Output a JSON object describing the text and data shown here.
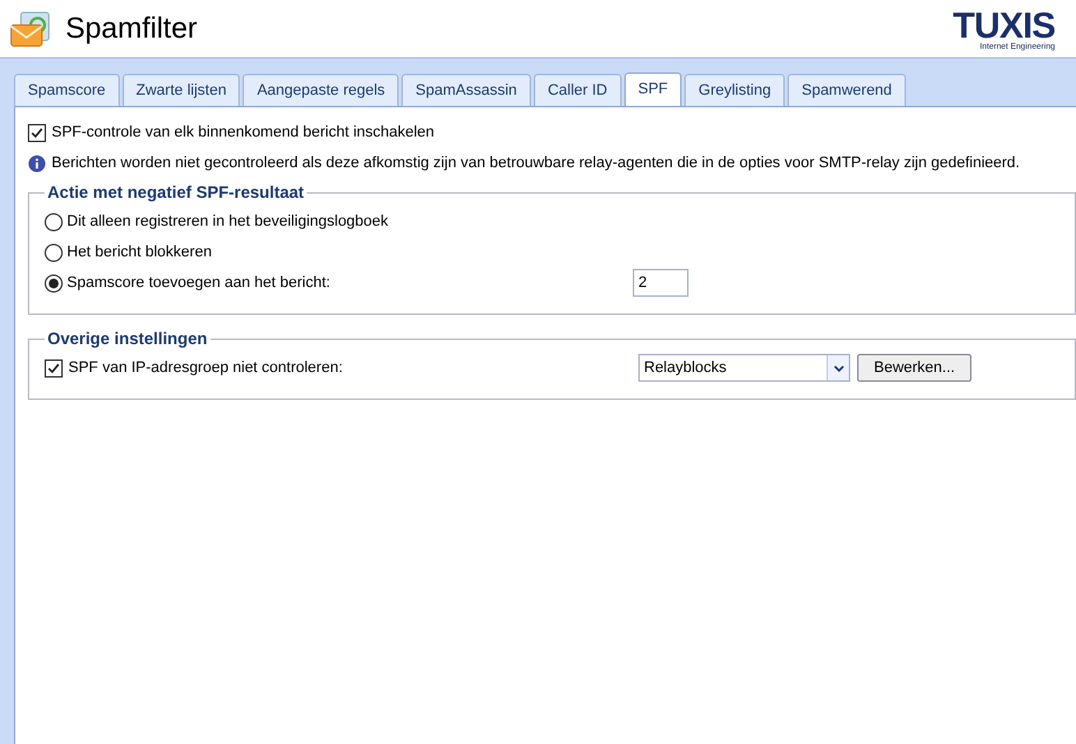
{
  "header": {
    "title": "Spamfilter",
    "logo": {
      "name": "TUXIS",
      "tagline": "Internet Engineering"
    }
  },
  "tabs": [
    {
      "label": "Spamscore",
      "selected": false
    },
    {
      "label": "Zwarte lijsten",
      "selected": false
    },
    {
      "label": "Aangepaste regels",
      "selected": false
    },
    {
      "label": "SpamAssassin",
      "selected": false
    },
    {
      "label": "Caller ID",
      "selected": false
    },
    {
      "label": "SPF",
      "selected": true
    },
    {
      "label": "Greylisting",
      "selected": false
    },
    {
      "label": "Spamwerend",
      "selected": false
    }
  ],
  "enable": {
    "label": "SPF-controle van elk binnenkomend bericht inschakelen",
    "checked": true
  },
  "info": "Berichten worden niet gecontroleerd als deze afkomstig zijn van betrouwbare relay-agenten die in de opties voor SMTP-relay zijn gedefinieerd.",
  "action_group": {
    "title": "Actie met negatief SPF-resultaat",
    "options": [
      {
        "label": "Dit alleen registreren in het beveiligingslogboek",
        "selected": false
      },
      {
        "label": "Het bericht blokkeren",
        "selected": false
      },
      {
        "label": "Spamscore toevoegen aan het bericht:",
        "selected": true,
        "value": "2"
      }
    ]
  },
  "other_group": {
    "title": "Overige instellingen",
    "skip": {
      "label": "SPF van IP-adresgroep niet controleren:",
      "checked": true
    },
    "select": {
      "value": "Relayblocks"
    },
    "button": "Bewerken..."
  }
}
